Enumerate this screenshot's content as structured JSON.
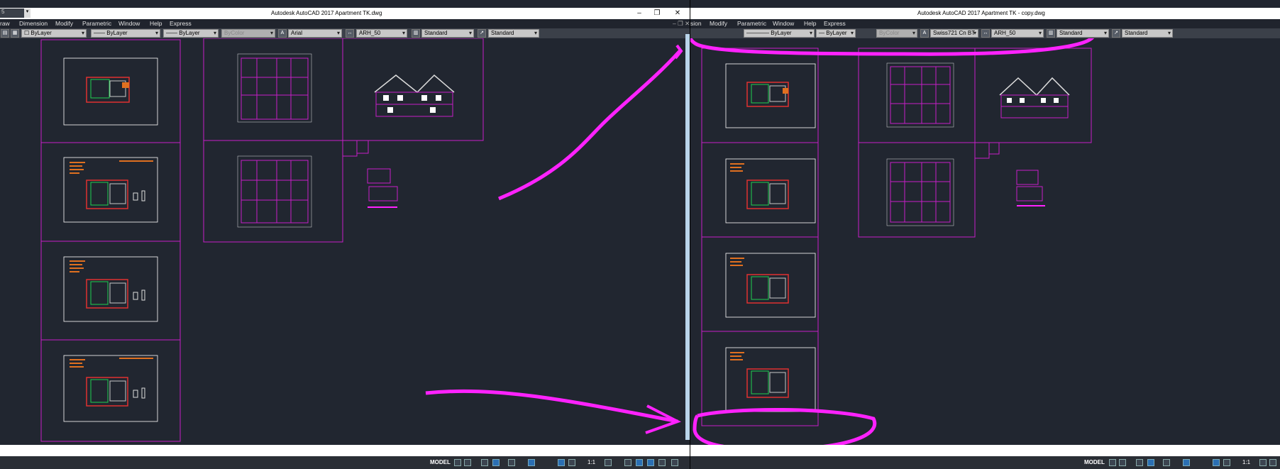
{
  "left": {
    "title": "Autodesk AutoCAD 2017    Apartment TK.dwg",
    "tab_stub": "5",
    "menu": [
      "raw",
      "Dimension",
      "Modify",
      "Parametric",
      "Window",
      "Help",
      "Express"
    ],
    "toolbar": {
      "layer": "ByLayer",
      "linetype": "ByLayer",
      "lineweight": "ByLayer",
      "plotstyle": "ByColor",
      "text_style": "Arial",
      "dim_style": "ARH_50",
      "table_style": "Standard",
      "multileader_style": "Standard"
    },
    "status": {
      "model": "MODEL",
      "scale": "1:1"
    }
  },
  "right": {
    "title": "Autodesk AutoCAD 2017    Apartment TK - copy.dwg",
    "menu": [
      "sion",
      "Modify",
      "Parametric",
      "Window",
      "Help",
      "Express"
    ],
    "toolbar": {
      "layer": "ByLayer",
      "lineweight": "ByLayer",
      "plotstyle": "ByColor",
      "text_style": "Swiss721 Cn BT",
      "dim_style": "ARH_50",
      "table_style": "Standard",
      "multileader_style": "Standard"
    },
    "status": {
      "model": "MODEL",
      "scale": "1:1"
    }
  },
  "colors": {
    "canvas": "#212630",
    "sheet_border": "#c81ec8",
    "annotation": "#ff22ff"
  }
}
